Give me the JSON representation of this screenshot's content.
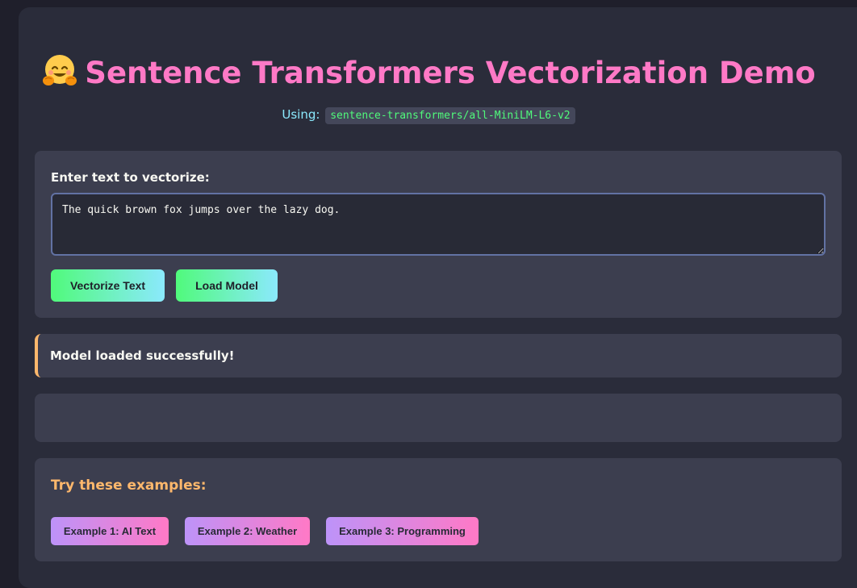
{
  "header": {
    "title": "Sentence Transformers Vectorization Demo",
    "emoji_icon": "hugging-face-emoji",
    "using_label": "Using:",
    "model_name": "sentence-transformers/all-MiniLM-L6-v2"
  },
  "input": {
    "label": "Enter text to vectorize:",
    "value": "The quick brown fox jumps over the lazy dog."
  },
  "actions": {
    "vectorize_label": "Vectorize Text",
    "load_model_label": "Load Model"
  },
  "status": {
    "message": "Model loaded successfully!"
  },
  "examples": {
    "title": "Try these examples:",
    "items": [
      {
        "label": "Example 1: AI Text"
      },
      {
        "label": "Example 2: Weather"
      },
      {
        "label": "Example 3: Programming"
      }
    ]
  },
  "colors": {
    "background": "#1f1f2b",
    "card": "#2a2c3a",
    "panel": "#3c3e4f",
    "title_pink": "#ff79c6",
    "cyan": "#8be9fd",
    "green": "#50fa7b",
    "orange": "#ffb86c",
    "purple": "#bd93f9"
  }
}
